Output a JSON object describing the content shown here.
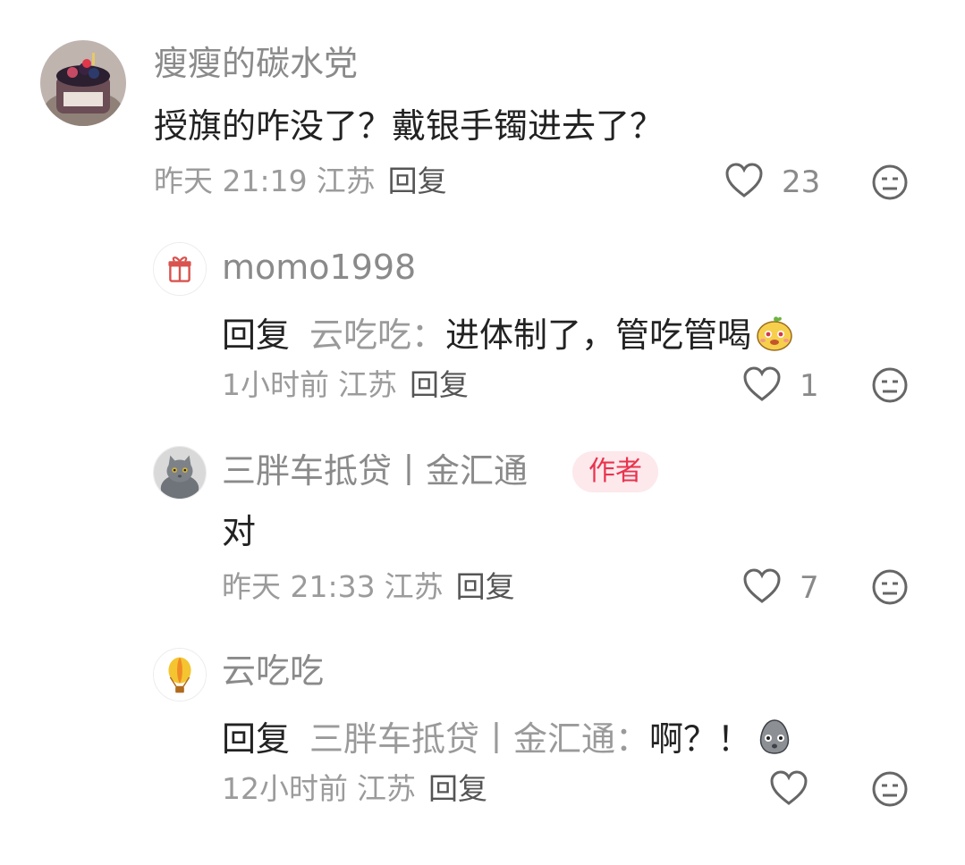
{
  "comments": [
    {
      "username": "瘦瘦的碳水党",
      "text": "授旗的咋没了？戴银手镯进去了？",
      "time": "昨天 21:19",
      "location": "江苏",
      "reply_label": "回复",
      "likes": "23"
    }
  ],
  "replies": [
    {
      "username": "momo1998",
      "reply_prefix": "回复",
      "reply_target": "云吃吃：",
      "text": "进体制了，管吃管喝",
      "emoji": "yellow-face-emoji",
      "time": "1小时前",
      "location": "江苏",
      "reply_label": "回复",
      "likes": "1"
    },
    {
      "username": "三胖车抵贷丨金汇通",
      "badge": "作者",
      "text": "对",
      "time": "昨天 21:33",
      "location": "江苏",
      "reply_label": "回复",
      "likes": "7"
    },
    {
      "username": "云吃吃",
      "reply_prefix": "回复",
      "reply_target": "三胖车抵贷丨金汇通：",
      "text": "啊？！",
      "emoji": "gray-face-emoji",
      "time": "12小时前",
      "location": "江苏",
      "reply_label": "回复",
      "likes": ""
    }
  ],
  "colors": {
    "username": "#8a8a8a",
    "text": "#222222",
    "meta": "#9b9b9b",
    "badge_bg": "#fde8ec",
    "badge_text": "#e8344e"
  }
}
